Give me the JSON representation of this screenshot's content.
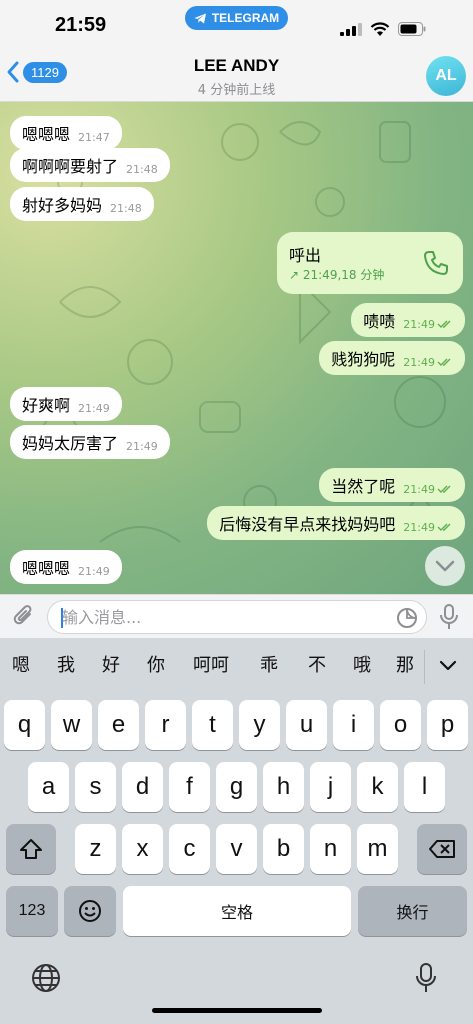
{
  "status_bar": {
    "time": "21:59",
    "app_pill": "TELEGRAM"
  },
  "header": {
    "back_count": "1129",
    "title": "LEE ANDY",
    "subtitle": "4 分钟前上线",
    "avatar_initials": "AL"
  },
  "messages": [
    {
      "dir": "in",
      "text": "嗯嗯嗯",
      "time": "21:47"
    },
    {
      "dir": "in",
      "text": "啊啊啊要射了",
      "time": "21:48"
    },
    {
      "dir": "in",
      "text": "射好多妈妈",
      "time": "21:48"
    },
    {
      "dir": "out",
      "type": "call",
      "text": "呼出",
      "meta": "↗ 21:49,18 分钟"
    },
    {
      "dir": "out",
      "text": "啧啧",
      "time": "21:49"
    },
    {
      "dir": "out",
      "text": "贱狗狗呢",
      "time": "21:49"
    },
    {
      "dir": "in",
      "text": "好爽啊",
      "time": "21:49"
    },
    {
      "dir": "in",
      "text": "妈妈太厉害了",
      "time": "21:49"
    },
    {
      "dir": "out",
      "text": "当然了呢",
      "time": "21:49"
    },
    {
      "dir": "out",
      "text": "后悔没有早点来找妈妈吧",
      "time": "21:49"
    },
    {
      "dir": "in",
      "text": "嗯嗯嗯",
      "time": "21:49"
    }
  ],
  "composer": {
    "placeholder": "输入消息..."
  },
  "keyboard": {
    "candidates": [
      "嗯",
      "我",
      "好",
      "你",
      "呵呵",
      "乖",
      "不",
      "哦",
      "那"
    ],
    "row1": [
      "q",
      "w",
      "e",
      "r",
      "t",
      "y",
      "u",
      "i",
      "o",
      "p"
    ],
    "row2": [
      "a",
      "s",
      "d",
      "f",
      "g",
      "h",
      "j",
      "k",
      "l"
    ],
    "row3": [
      "z",
      "x",
      "c",
      "v",
      "b",
      "n",
      "m"
    ],
    "numbers_key": "123",
    "space_key": "空格",
    "return_key": "换行"
  },
  "colors": {
    "accent": "#2f8fe6",
    "outgoing_bubble": "#e4f7cb",
    "incoming_bubble": "#ffffff",
    "read_ticks": "#5db04c"
  }
}
